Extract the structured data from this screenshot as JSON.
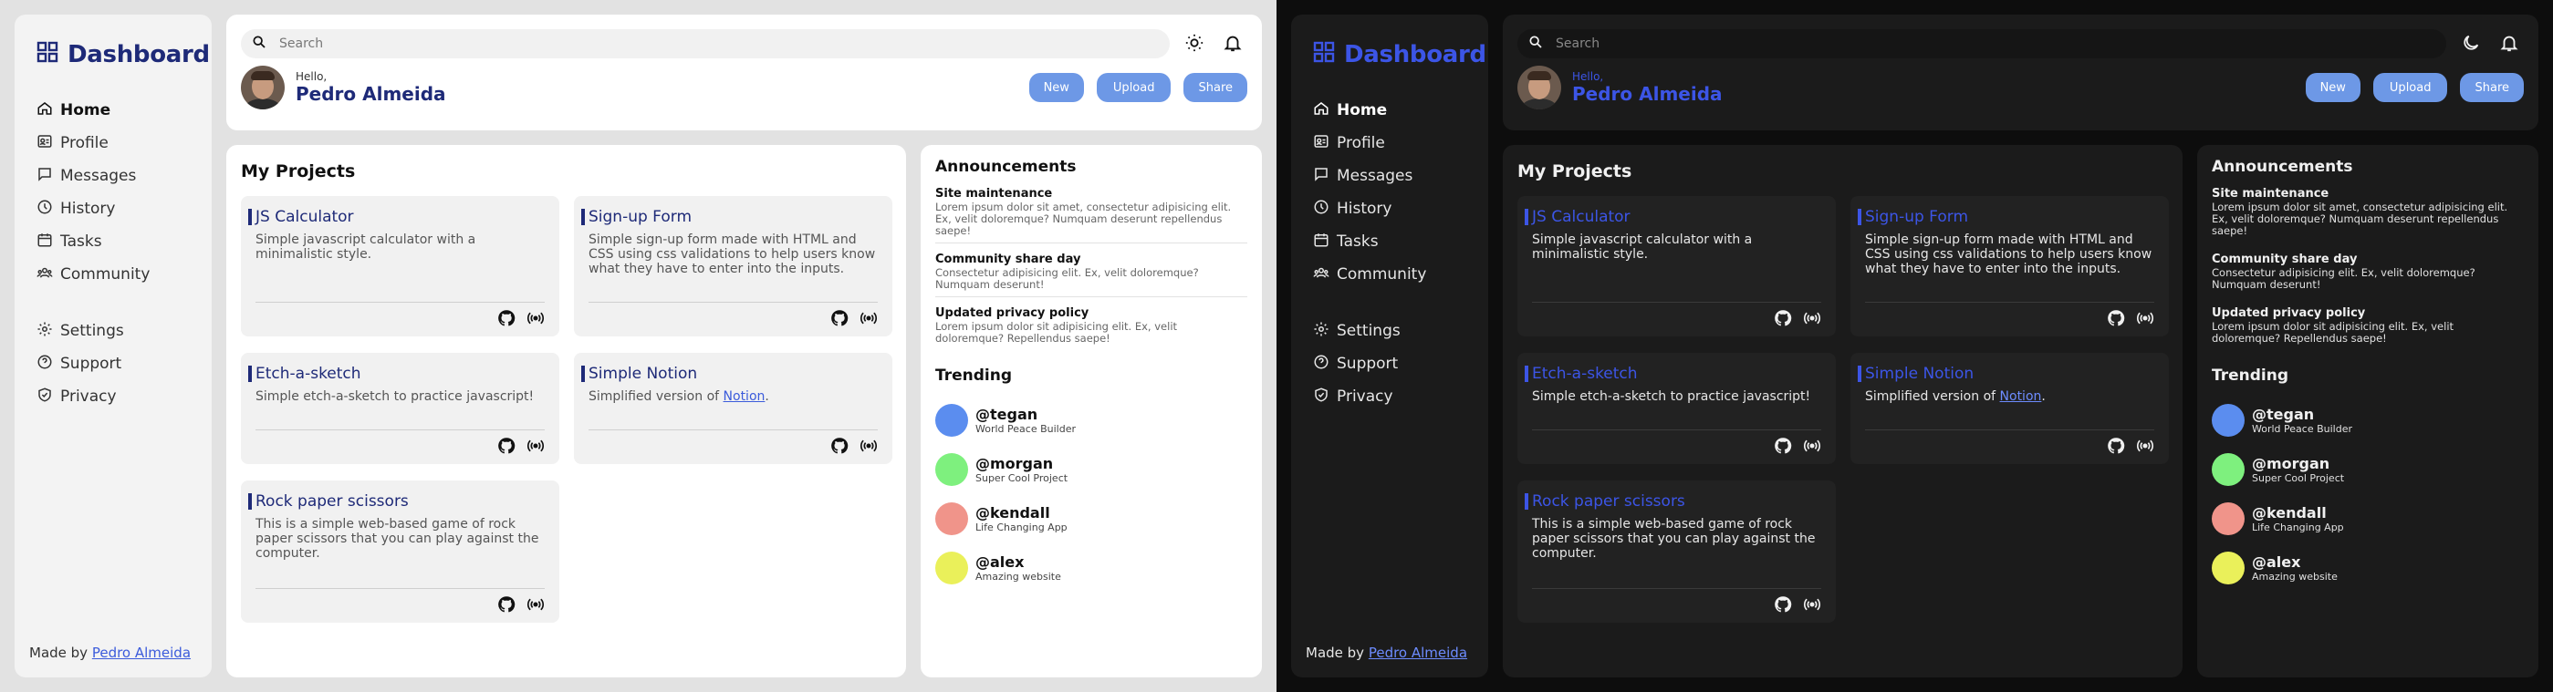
{
  "brand": "Dashboard",
  "nav_main": [
    {
      "label": "Home",
      "icon": "home-icon"
    },
    {
      "label": "Profile",
      "icon": "profile-icon"
    },
    {
      "label": "Messages",
      "icon": "messages-icon"
    },
    {
      "label": "History",
      "icon": "history-icon"
    },
    {
      "label": "Tasks",
      "icon": "tasks-icon"
    },
    {
      "label": "Community",
      "icon": "community-icon"
    }
  ],
  "nav_secondary": [
    {
      "label": "Settings",
      "icon": "settings-icon"
    },
    {
      "label": "Support",
      "icon": "support-icon"
    },
    {
      "label": "Privacy",
      "icon": "privacy-icon"
    }
  ],
  "footer": {
    "prefix": "Made by ",
    "link": "Pedro Almeida"
  },
  "search": {
    "placeholder": "Search"
  },
  "greeting": {
    "hello": "Hello,",
    "name": "Pedro Almeida"
  },
  "actions": {
    "new": "New",
    "upload": "Upload",
    "share": "Share"
  },
  "projects": {
    "title": "My Projects",
    "items": [
      {
        "title": "JS Calculator",
        "desc": "Simple javascript calculator with a minimalistic style."
      },
      {
        "title": "Sign-up Form",
        "desc": "Simple sign-up form made with HTML and CSS using css validations to help users know what they have to enter into the inputs."
      },
      {
        "title": "Etch-a-sketch",
        "desc": "Simple etch-a-sketch to practice javascript!"
      },
      {
        "title": "Simple Notion",
        "desc": "Simplified version of ",
        "link": "Notion",
        "suffix": "."
      },
      {
        "title": "Rock paper scissors",
        "desc": "This is a simple web-based game of rock paper scissors that you can play against the computer."
      }
    ]
  },
  "announcements": {
    "title": "Announcements",
    "items": [
      {
        "title": "Site maintenance",
        "text": "Lorem ipsum dolor sit amet, consectetur adipisicing elit. Ex, velit doloremque? Numquam deserunt repellendus saepe!"
      },
      {
        "title": "Community share day",
        "text": "Consectetur adipisicing elit. Ex, velit doloremque? Numquam deserunt!"
      },
      {
        "title": "Updated privacy policy",
        "text": "Lorem ipsum dolor sit adipisicing elit. Ex, velit doloremque? Repellendus saepe!"
      }
    ]
  },
  "trending": {
    "title": "Trending",
    "items": [
      {
        "user": "@tegan",
        "sub": "World Peace Builder",
        "color": "#5b8def"
      },
      {
        "user": "@morgan",
        "sub": "Super Cool Project",
        "color": "#7ef07e"
      },
      {
        "user": "@kendall",
        "sub": "Life Changing App",
        "color": "#f0948a"
      },
      {
        "user": "@alex",
        "sub": "Amazing website",
        "color": "#eaf05a"
      }
    ]
  },
  "colors": {
    "accent": "#1e2a78",
    "accent_dark": "#3c55e6",
    "button": "#6d98e6"
  }
}
